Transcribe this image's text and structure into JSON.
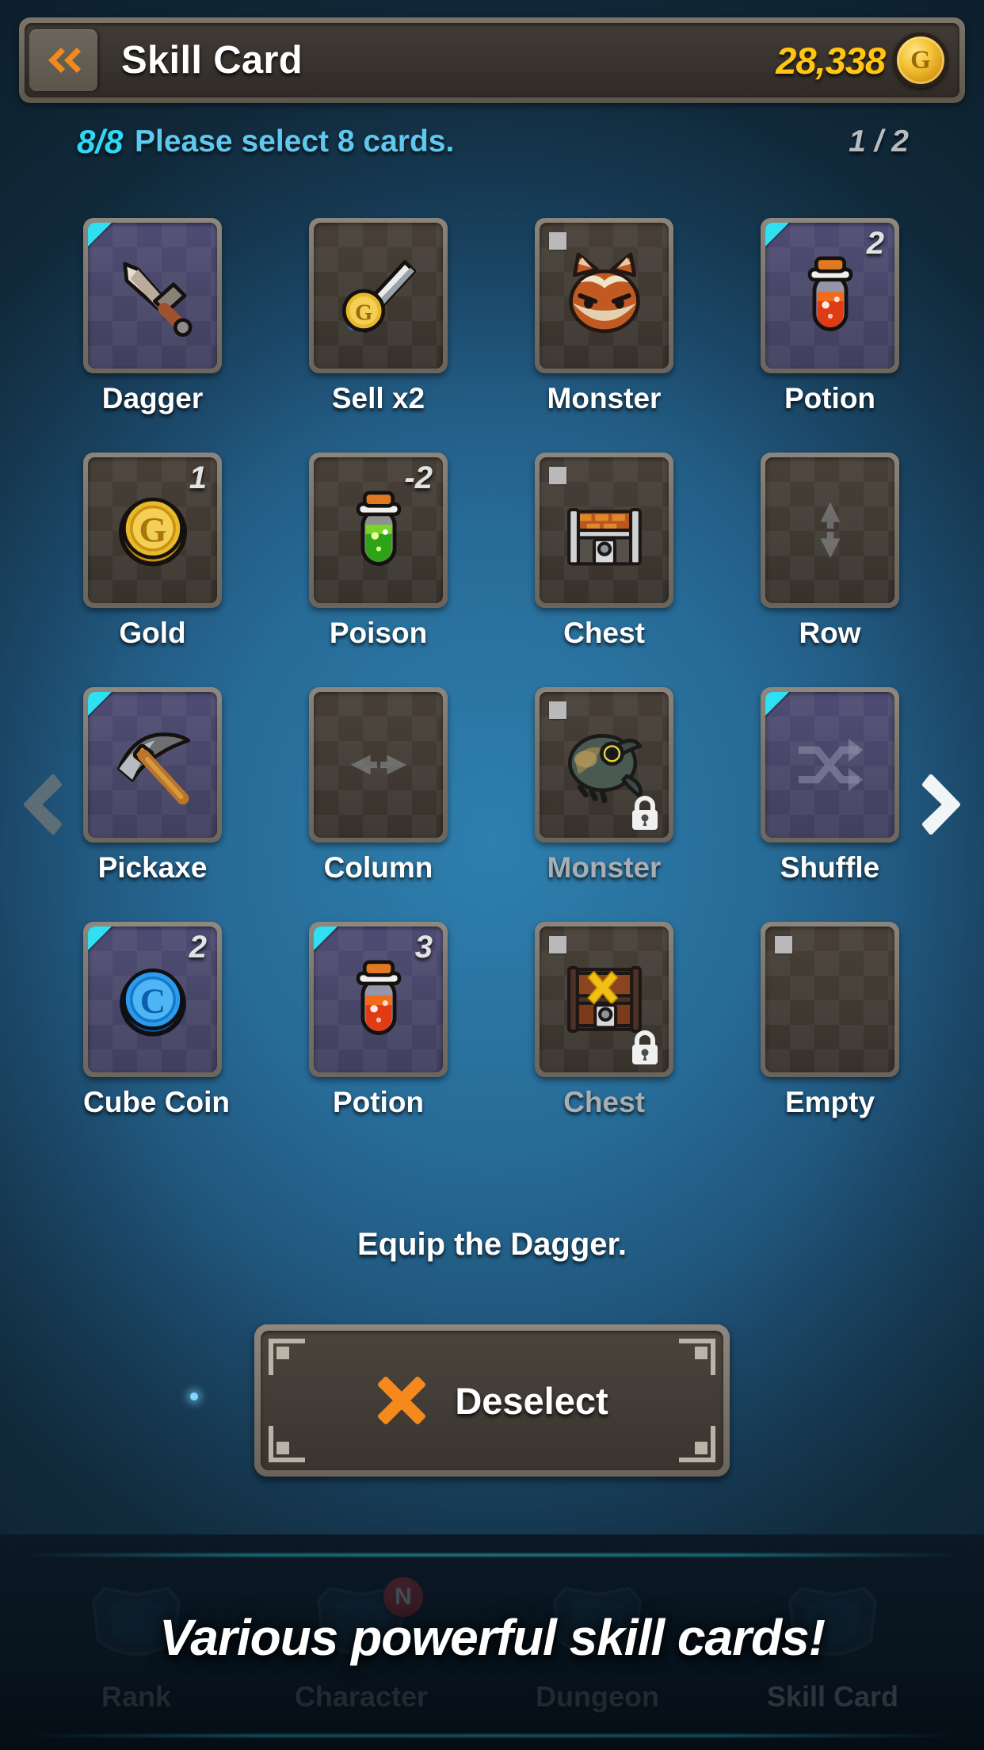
{
  "header": {
    "back_icon": "double-chevron-left-icon",
    "title": "Skill Card",
    "gold_amount": "28,338",
    "gold_icon": "gold-coin-icon",
    "gold_letter": "G"
  },
  "sub_header": {
    "count": "8/8",
    "instruction": "Please select 8 cards.",
    "page": "1 / 2"
  },
  "pager": {
    "prev_icon": "chevron-left-icon",
    "next_icon": "chevron-right-icon"
  },
  "cards": [
    {
      "label": "Dagger",
      "art": "dagger",
      "selected": true,
      "badge": null,
      "square": false,
      "locked": false
    },
    {
      "label": "Sell x2",
      "art": "sell-sword",
      "selected": false,
      "badge": null,
      "square": false,
      "locked": false
    },
    {
      "label": "Monster",
      "art": "fox-head",
      "selected": false,
      "badge": null,
      "square": true,
      "locked": false
    },
    {
      "label": "Potion",
      "art": "potion-red",
      "selected": true,
      "badge": "2",
      "square": false,
      "locked": false
    },
    {
      "label": "Gold",
      "art": "gold-coin",
      "selected": false,
      "badge": "1",
      "square": false,
      "locked": false
    },
    {
      "label": "Poison",
      "art": "potion-green",
      "selected": false,
      "badge": "-2",
      "square": false,
      "locked": false
    },
    {
      "label": "Chest",
      "art": "chest-open",
      "selected": false,
      "badge": null,
      "square": true,
      "locked": false
    },
    {
      "label": "Row",
      "art": "row-arrows",
      "selected": false,
      "badge": null,
      "square": false,
      "locked": false
    },
    {
      "label": "Pickaxe",
      "art": "pickaxe",
      "selected": true,
      "badge": null,
      "square": false,
      "locked": false
    },
    {
      "label": "Column",
      "art": "column-arrows",
      "selected": false,
      "badge": null,
      "square": false,
      "locked": false
    },
    {
      "label": "Monster",
      "art": "fish-monster",
      "selected": false,
      "badge": null,
      "square": true,
      "locked": true
    },
    {
      "label": "Shuffle",
      "art": "shuffle-arrows",
      "selected": true,
      "badge": null,
      "square": false,
      "locked": false
    },
    {
      "label": "Cube Coin",
      "art": "cube-coin",
      "selected": true,
      "badge": "2",
      "square": false,
      "locked": false
    },
    {
      "label": "Potion",
      "art": "potion-red",
      "selected": true,
      "badge": "3",
      "square": false,
      "locked": false
    },
    {
      "label": "Chest",
      "art": "chest-locked",
      "selected": false,
      "badge": null,
      "square": true,
      "locked": true
    },
    {
      "label": "Empty",
      "art": "empty",
      "selected": false,
      "badge": null,
      "square": true,
      "locked": false
    }
  ],
  "description": "Equip the Dagger.",
  "deselect_button": {
    "icon": "cross-x-icon",
    "label": "Deselect"
  },
  "bottom_nav": {
    "items": [
      {
        "label": "Rank",
        "badge": null,
        "active": false
      },
      {
        "label": "Character",
        "badge": "N",
        "active": false
      },
      {
        "label": "Dungeon",
        "badge": null,
        "active": false
      },
      {
        "label": "Skill Card",
        "badge": null,
        "active": true
      }
    ]
  },
  "promo": {
    "text": "Various powerful skill cards!"
  },
  "colors": {
    "accent_cyan": "#2fe0f2",
    "gold": "#ffc713",
    "instruction_blue": "#5ec8ef",
    "orange": "#f08a1c",
    "selected_card_bg": "#484667",
    "unselected_card_bg": "#3f3932"
  }
}
